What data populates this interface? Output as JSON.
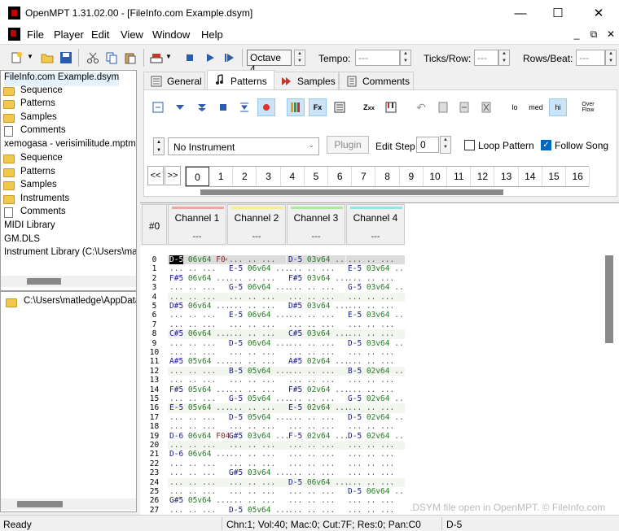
{
  "window": {
    "title": "OpenMPT 1.31.02.00 - [FileInfo.com Example.dsym]",
    "minimize": "—",
    "maximize": "☐",
    "close": "✕"
  },
  "menu": {
    "items": [
      "File",
      "Player",
      "Edit",
      "View",
      "Window",
      "Help"
    ],
    "mdi": [
      "_",
      "⧉",
      "✕"
    ]
  },
  "toolbar": {
    "octave": "Octave 4",
    "tempo_label": "Tempo:",
    "tempo_value": "---",
    "ticks_label": "Ticks/Row:",
    "ticks_value": "---",
    "rows_label": "Rows/Beat:",
    "rows_value": "---"
  },
  "tree": {
    "items": [
      {
        "label": "FileInfo.com Example.dsym",
        "icon": "none"
      },
      {
        "label": "Sequence",
        "icon": "folder"
      },
      {
        "label": "Patterns",
        "icon": "folder"
      },
      {
        "label": "Samples",
        "icon": "folder"
      },
      {
        "label": "Comments",
        "icon": "document"
      },
      {
        "label": "xemogasa - verisimilitude.mptm",
        "icon": "none"
      },
      {
        "label": "Sequence",
        "icon": "folder"
      },
      {
        "label": "Patterns",
        "icon": "folder"
      },
      {
        "label": "Samples",
        "icon": "folder"
      },
      {
        "label": "Instruments",
        "icon": "folder"
      },
      {
        "label": "Comments",
        "icon": "document"
      },
      {
        "label": "MIDI Library",
        "icon": "none"
      },
      {
        "label": "GM.DLS",
        "icon": "none"
      },
      {
        "label": "Instrument Library (C:\\Users\\ma",
        "icon": "none"
      }
    ]
  },
  "tree2": {
    "path": "C:\\Users\\matledge\\AppData"
  },
  "tabs": [
    "General",
    "Patterns",
    "Samples",
    "Comments"
  ],
  "pattern_toolbar": {
    "lo": "lo",
    "med": "med",
    "hi": "hi",
    "overflow": "Over Flow"
  },
  "instrument": {
    "selected": "No Instrument",
    "plugin": "Plugin",
    "edit_step_label": "Edit Step",
    "edit_step": "0",
    "loop_pattern": "Loop Pattern",
    "follow_song": "Follow Song"
  },
  "sequence": {
    "prev": "<<",
    "next": ">>",
    "orders": [
      "0",
      "1",
      "2",
      "3",
      "4",
      "5",
      "6",
      "7",
      "8",
      "9",
      "10",
      "11",
      "12",
      "13",
      "14",
      "15",
      "16"
    ]
  },
  "pattern": {
    "number": "#0",
    "channels": [
      {
        "name": "Channel 1",
        "plugin": "---",
        "color": "#f4a3a3"
      },
      {
        "name": "Channel 2",
        "plugin": "---",
        "color": "#f7ef8a"
      },
      {
        "name": "Channel 3",
        "plugin": "---",
        "color": "#a8ec9a"
      },
      {
        "name": "Channel 4",
        "plugin": "---",
        "color": "#8ee8e8"
      }
    ],
    "rows": [
      [
        "D-5 06v64 F04",
        "... .. ... ...",
        "D-5 03v64 ...",
        "... .. ... ..."
      ],
      [
        "... .. ... ...",
        "E-5 06v64 ...",
        "... .. ... ...",
        "E-5 03v64 ..."
      ],
      [
        "F#5 06v64 ...",
        "... .. ... ...",
        "F#5 03v64 ...",
        "... .. ... ..."
      ],
      [
        "... .. ... F06",
        "G-5 06v64 ...",
        "... .. ... ...",
        "G-5 03v64 ..."
      ],
      [
        "... .. ... ...",
        "... .. ... ...",
        "... .. ... ...",
        "... .. ... ..."
      ],
      [
        "D#5 06v64 ...",
        "... .. ... ...",
        "D#5 03v64 ...",
        "... .. ... ..."
      ],
      [
        "... .. ... ...",
        "E-5 06v64 ...",
        "... .. ... ...",
        "E-5 03v64 ..."
      ],
      [
        "... .. ... ...",
        "... .. ... ...",
        "... .. ... ...",
        "... .. ... ..."
      ],
      [
        "C#5 06v64 ...",
        "... .. ... ...",
        "C#5 03v64 ...",
        "... .. ... ..."
      ],
      [
        "... .. ... ...",
        "D-5 06v64 ...",
        "... .. ... ...",
        "D-5 03v64 ..."
      ],
      [
        "... .. ... ...",
        "... .. ... ...",
        "... .. ... ...",
        "... .. ... ..."
      ],
      [
        "A#5 05v64 ...",
        "... .. ... ...",
        "A#5 02v64 ...",
        "... .. ... ..."
      ],
      [
        "... .. ... ...",
        "B-5 05v64 ...",
        "... .. ... ...",
        "B-5 02v64 ..."
      ],
      [
        "... .. ... ...",
        "... .. ... ...",
        "... .. ... ...",
        "... .. ... ..."
      ],
      [
        "F#5 05v64 ...",
        "... .. ... ...",
        "F#5 02v64 ...",
        "... .. ... ..."
      ],
      [
        "... .. ... ...",
        "G-5 05v64 ...",
        "... .. ... ...",
        "G-5 02v64 ..."
      ],
      [
        "E-5 05v64 ...",
        "... .. ... ...",
        "E-5 02v64 ...",
        "... .. ... ..."
      ],
      [
        "... .. ... ...",
        "D-5 05v64 ...",
        "... .. ... ...",
        "D-5 02v64 ..."
      ],
      [
        "... .. ... ...",
        "... .. ... ...",
        "... .. ... ...",
        "... .. ... ..."
      ],
      [
        "D-6 06v64 F04",
        "G#5 03v64 ...",
        "F-5 02v64 ...",
        "D-5 02v64 ..."
      ],
      [
        "... .. ... ...",
        "... .. ... ...",
        "... .. ... ...",
        "... .. ... ..."
      ],
      [
        "D-6 06v64 ...",
        "... .. ... ...",
        "... .. ... ...",
        "... .. ... ..."
      ],
      [
        "... .. ... ...",
        "... .. ... ...",
        "... .. ... ...",
        "... .. ... ..."
      ],
      [
        "... .. ... ...",
        "G#5 03v64 ...",
        "... .. ... ...",
        "... .. ... ..."
      ],
      [
        "... .. ... ...",
        "... .. ... ...",
        "D-5 06v64 ...",
        "... .. ... ..."
      ],
      [
        "... .. ... ...",
        "... .. ... ...",
        "... .. ... ...",
        "D-5 06v64 ..."
      ],
      [
        "G#5 05v64 ...",
        "... .. ... ...",
        "... .. ... ...",
        "... .. ... ..."
      ],
      [
        "... .. ... ...",
        "D-5 05v64 ...",
        "... .. ... ...",
        "... .. ... ..."
      ]
    ]
  },
  "watermark": ".DSYM file open in OpenMPT. © FileInfo.com",
  "status": {
    "ready": "Ready",
    "info": "Chn:1; Vol:40; Mac:0; Cut:7F; Res:0; Pan:C0",
    "note": "D-5"
  }
}
